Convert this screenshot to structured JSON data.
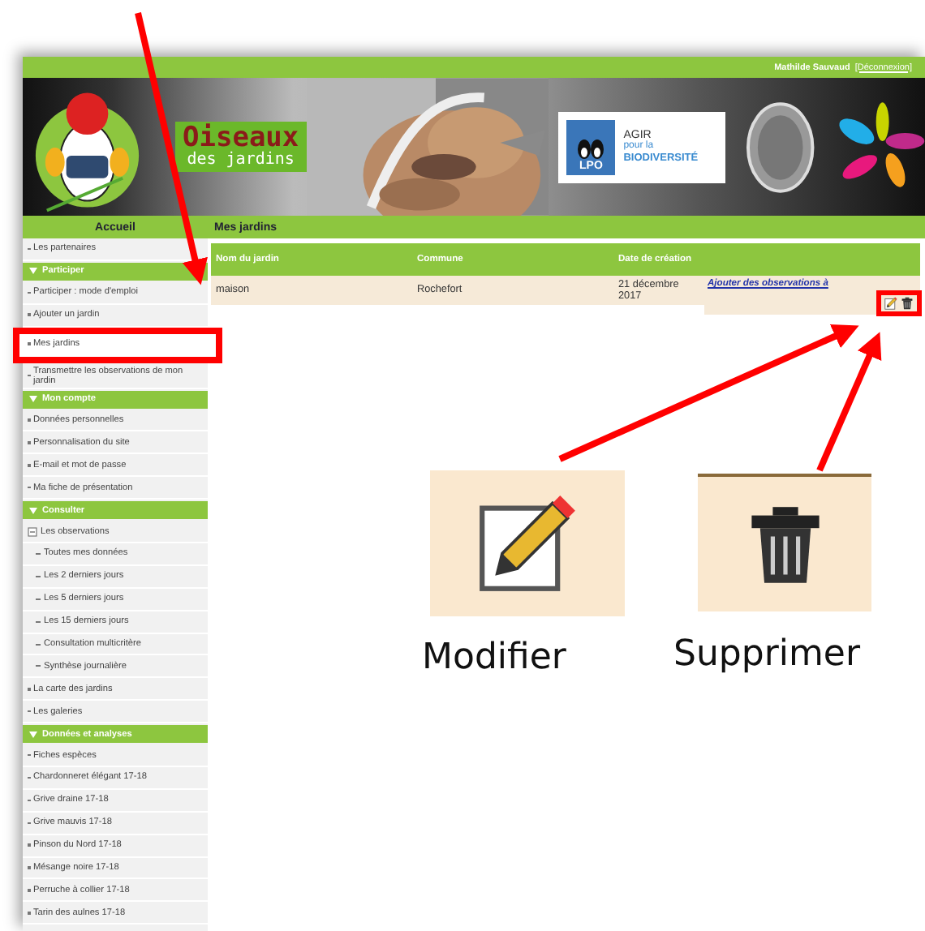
{
  "top_bar": {
    "user": "Mathilde Sauvaud",
    "logout": "[Déconnexion]"
  },
  "banner": {
    "site_name": "Oiseaux",
    "site_subtitle": "des jardins",
    "partner_badge": "LPO",
    "partner_line_1": "AGIR",
    "partner_line_2": "pour la",
    "partner_line_3": "BIODIVERSITÉ"
  },
  "nav": {
    "home": "Accueil",
    "page_title": "Mes jardins"
  },
  "sidebar": [
    {
      "kind": "link",
      "label": "Les partenaires",
      "highlighted": false
    },
    {
      "kind": "section",
      "label": "Participer"
    },
    {
      "kind": "link",
      "label": "Participer : mode d'emploi",
      "highlighted": false
    },
    {
      "kind": "link",
      "label": "Ajouter un jardin",
      "highlighted": false
    },
    {
      "kind": "link",
      "label": "Mes jardins",
      "highlighted": true
    },
    {
      "kind": "link",
      "label": "Transmettre les observations de mon jardin",
      "highlighted": false
    },
    {
      "kind": "section",
      "label": "Mon compte"
    },
    {
      "kind": "link",
      "label": "Données personnelles",
      "highlighted": false
    },
    {
      "kind": "link",
      "label": "Personnalisation du site",
      "highlighted": false
    },
    {
      "kind": "link",
      "label": "E-mail et mot de passe",
      "highlighted": false
    },
    {
      "kind": "link",
      "label": "Ma fiche de présentation",
      "highlighted": false
    },
    {
      "kind": "section",
      "label": "Consulter"
    },
    {
      "kind": "tree",
      "label": "Les observations",
      "expanded": true,
      "children": [
        {
          "label": "Toutes mes données"
        },
        {
          "label": "Les 2 derniers jours"
        },
        {
          "label": "Les 5 derniers jours"
        },
        {
          "label": "Les 15 derniers jours"
        },
        {
          "label": "Consultation multicritère"
        },
        {
          "label": "Synthèse journalière"
        }
      ]
    },
    {
      "kind": "link",
      "label": "La carte des jardins",
      "highlighted": false
    },
    {
      "kind": "link",
      "label": "Les galeries",
      "highlighted": false
    },
    {
      "kind": "section",
      "label": "Données et analyses"
    },
    {
      "kind": "link",
      "label": "Fiches espèces",
      "highlighted": false
    },
    {
      "kind": "link",
      "label": "Chardonneret élégant 17-18",
      "highlighted": false
    },
    {
      "kind": "link",
      "label": "Grive draine 17-18",
      "highlighted": false
    },
    {
      "kind": "link",
      "label": "Grive mauvis 17-18",
      "highlighted": false
    },
    {
      "kind": "link",
      "label": "Pinson du Nord 17-18",
      "highlighted": false
    },
    {
      "kind": "link",
      "label": "Mésange noire 17-18",
      "highlighted": false
    },
    {
      "kind": "link",
      "label": "Perruche à collier 17-18",
      "highlighted": false
    },
    {
      "kind": "link",
      "label": "Tarin des aulnes 17-18",
      "highlighted": false
    }
  ],
  "table": {
    "columns": [
      "Nom du jardin",
      "Commune",
      "Date de création"
    ],
    "rows": [
      {
        "cells": [
          "maison",
          "Rochefort",
          "21 décembre 2017"
        ],
        "action": "Ajouter des observations à",
        "actions_highlighted": true
      }
    ]
  },
  "callouts": [
    {
      "kind": "edit",
      "label": "Modifier"
    },
    {
      "kind": "delete",
      "label": "Supprimer"
    }
  ]
}
